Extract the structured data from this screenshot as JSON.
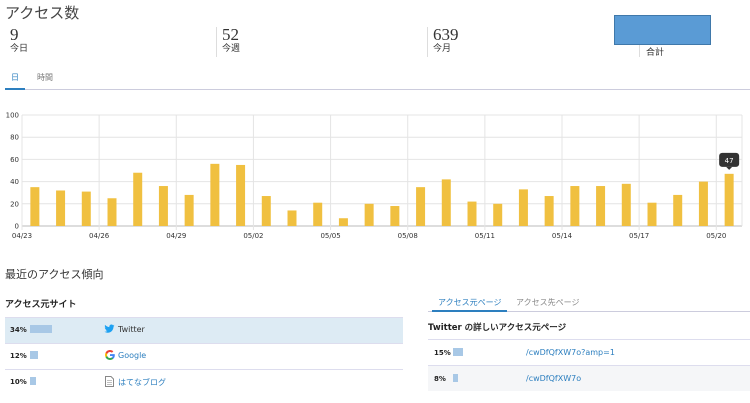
{
  "title": "アクセス数",
  "stats": [
    {
      "value": "9",
      "label": "今日"
    },
    {
      "value": "52",
      "label": "今週"
    },
    {
      "value": "639",
      "label": "今月"
    }
  ],
  "total_label": "合計",
  "tabs": [
    {
      "label": "日",
      "active": true
    },
    {
      "label": "時間",
      "active": false
    }
  ],
  "chart_data": {
    "type": "bar",
    "categories": [
      "04/23",
      "04/24",
      "04/25",
      "04/26",
      "04/27",
      "04/28",
      "04/29",
      "04/30",
      "05/01",
      "05/02",
      "05/03",
      "05/04",
      "05/05",
      "05/06",
      "05/07",
      "05/08",
      "05/09",
      "05/10",
      "05/11",
      "05/12",
      "05/13",
      "05/14",
      "05/15",
      "05/16",
      "05/17",
      "05/18",
      "05/19",
      "05/20"
    ],
    "values": [
      35,
      32,
      31,
      25,
      48,
      36,
      28,
      56,
      55,
      27,
      14,
      21,
      7,
      20,
      18,
      35,
      42,
      22,
      20,
      33,
      27,
      36,
      36,
      38,
      21,
      28,
      40,
      47
    ],
    "tick_labels": [
      "04/23",
      "04/26",
      "04/29",
      "05/02",
      "05/05",
      "05/08",
      "05/11",
      "05/14",
      "05/17",
      "05/20"
    ],
    "y_ticks": [
      0,
      20,
      40,
      60,
      80,
      100
    ],
    "ylim": [
      0,
      100
    ],
    "bar_color": "#f0c040",
    "tooltip": {
      "category": "05/20",
      "value": "47"
    },
    "grid": true
  },
  "trend_heading": "最近のアクセス傾向",
  "sources": {
    "title": "アクセス元サイト",
    "rows": [
      {
        "pct": "34%",
        "share": 0.34,
        "icon": "twitter-icon",
        "site": "Twitter",
        "selected": true
      },
      {
        "pct": "12%",
        "share": 0.12,
        "icon": "google-icon",
        "site": "Google",
        "selected": false
      },
      {
        "pct": "10%",
        "share": 0.1,
        "icon": "document-icon",
        "site": "はてなブログ",
        "selected": false
      }
    ]
  },
  "right": {
    "tabs": [
      {
        "label": "アクセス元ページ",
        "active": true
      },
      {
        "label": "アクセス先ページ",
        "active": false
      }
    ],
    "title": "Twitter の詳しいアクセス元ページ",
    "rows": [
      {
        "pct": "15%",
        "share": 0.15,
        "path": "/cwDfQfXW7o?amp=1"
      },
      {
        "pct": "8%",
        "share": 0.08,
        "path": "/cwDfQfXW7o"
      }
    ]
  }
}
